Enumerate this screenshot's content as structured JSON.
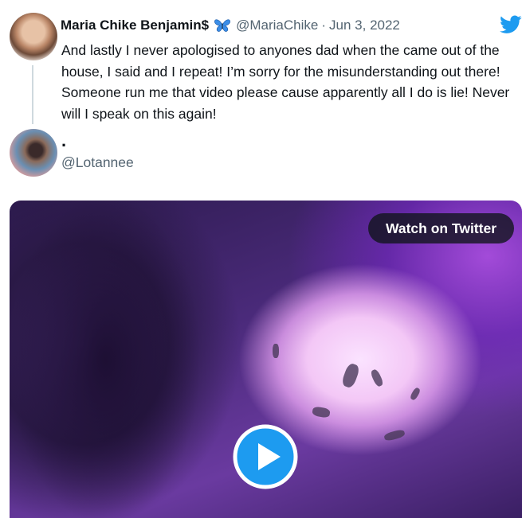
{
  "tweet": {
    "author_name": "Maria Chike Benjamin$",
    "author_emoji_icon": "butterfly-icon",
    "handle": "@MariaChike",
    "separator": "·",
    "date": "Jun 3, 2022",
    "text": "And lastly I never apologised to anyones dad when the came out of the house, I said and I repeat! I’m sorry for the misunderstanding out there! Someone run me that video please cause apparently all I do is lie! Never will I speak on this again!"
  },
  "reply": {
    "name": ".",
    "handle": "@Lotannee"
  },
  "video": {
    "watch_label": "Watch on Twitter",
    "play_icon": "play-icon"
  },
  "brand": {
    "icon": "twitter-bird-icon",
    "color": "#1d9bf0"
  }
}
